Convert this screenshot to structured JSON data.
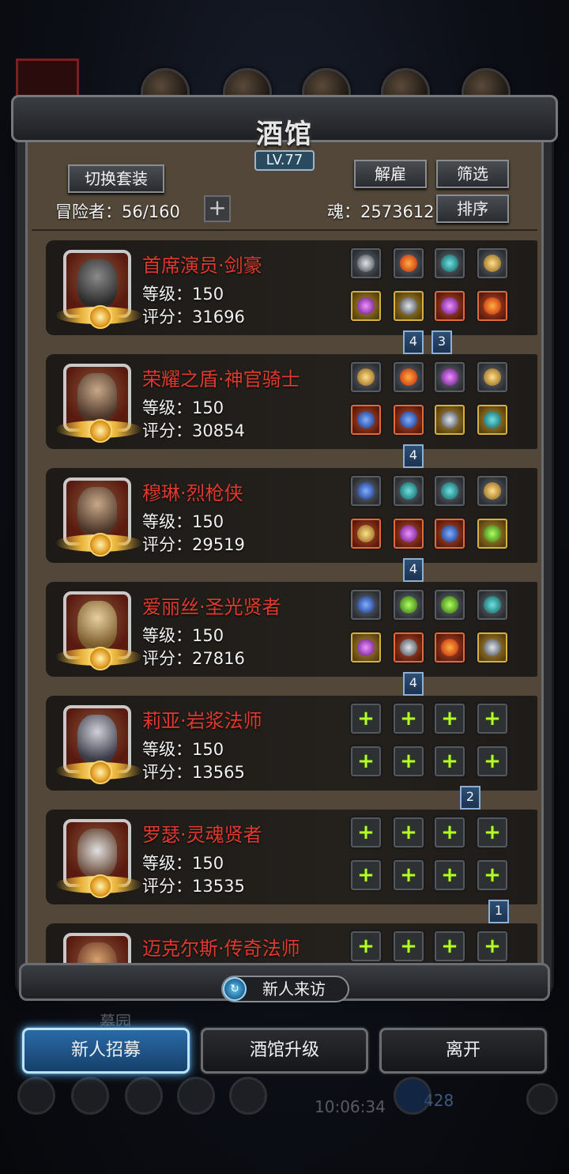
{
  "title": "酒馆",
  "level": "LV.77",
  "controls": {
    "switch_outfit": "切换套装",
    "dismiss": "解雇",
    "filter": "筛选",
    "sort": "排序",
    "adventurers": "冒险者：56/160",
    "soul": "魂：2573612",
    "add": "+"
  },
  "heroes": [
    {
      "name": "首席演员·剑豪",
      "level": "等级：150",
      "score": "评分：31696"
    },
    {
      "name": "荣耀之盾·神官骑士",
      "level": "等级：150",
      "score": "评分：30854"
    },
    {
      "name": "穆琳·烈枪侠",
      "level": "等级：150",
      "score": "评分：29519"
    },
    {
      "name": "爱丽丝·圣光贤者",
      "level": "等级：150",
      "score": "评分：27816"
    },
    {
      "name": "莉亚·岩浆法师",
      "level": "等级：150",
      "score": "评分：13565"
    },
    {
      "name": "罗瑟·灵魂贤者",
      "level": "等级：150",
      "score": "评分：13535"
    },
    {
      "name": "迈克尔斯·传奇法师",
      "level": "",
      "score": ""
    }
  ],
  "markers": [
    "4",
    "3",
    "4",
    "4",
    "4",
    "2",
    "1"
  ],
  "visit_button": "新人来访",
  "bottom_buttons": {
    "recruit": "新人招募",
    "upgrade": "酒馆升级",
    "leave": "离开"
  },
  "background": {
    "graveyard": "墓园",
    "clock": "10:06:34",
    "gems": "428"
  },
  "icons": [
    "gear-icon",
    "star-icon",
    "scroll-icon",
    "mail-icon",
    "shield-icon",
    "plus-icon"
  ]
}
